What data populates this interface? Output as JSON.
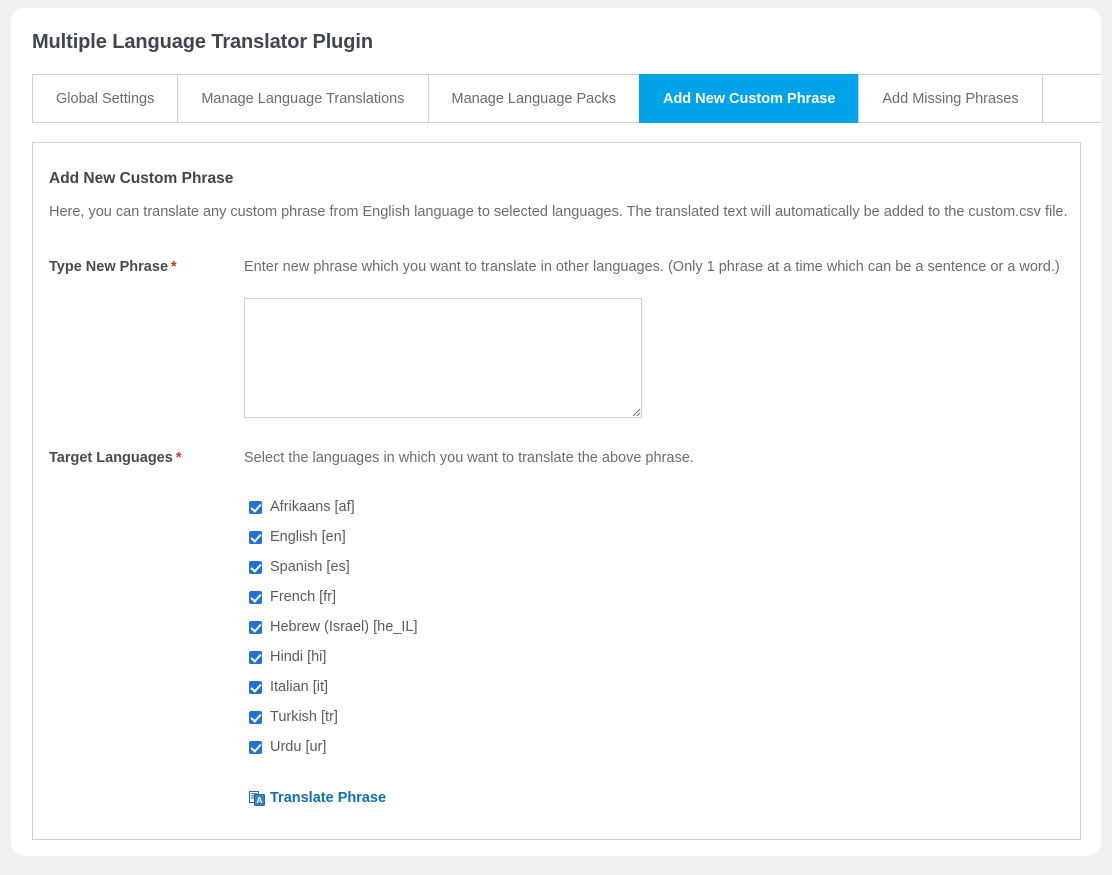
{
  "header": {
    "title": "Multiple Language Translator Plugin"
  },
  "tabs": [
    {
      "label": "Global Settings",
      "active": false
    },
    {
      "label": "Manage Language Translations",
      "active": false
    },
    {
      "label": "Manage Language Packs",
      "active": false
    },
    {
      "label": "Add New Custom Phrase",
      "active": true
    },
    {
      "label": "Add Missing Phrases",
      "active": false
    }
  ],
  "panel": {
    "title": "Add New Custom Phrase",
    "description": "Here, you can translate any custom phrase from English language to selected languages. The translated text will automatically be added to the custom.csv file."
  },
  "form": {
    "phrase": {
      "label": "Type New Phrase",
      "required_marker": "*",
      "help": "Enter new phrase which you want to translate in other languages. (Only 1 phrase at a time which can be a sentence or a word.)",
      "value": "",
      "placeholder": ""
    },
    "languages": {
      "label": "Target Languages",
      "required_marker": "*",
      "help": "Select the languages in which you want to translate the above phrase.",
      "items": [
        {
          "label": "Afrikaans [af]",
          "checked": true
        },
        {
          "label": "English [en]",
          "checked": true
        },
        {
          "label": "Spanish [es]",
          "checked": true
        },
        {
          "label": "French [fr]",
          "checked": true
        },
        {
          "label": "Hebrew (Israel) [he_IL]",
          "checked": true
        },
        {
          "label": "Hindi [hi]",
          "checked": true
        },
        {
          "label": "Italian [it]",
          "checked": true
        },
        {
          "label": "Turkish [tr]",
          "checked": true
        },
        {
          "label": "Urdu [ur]",
          "checked": true
        }
      ]
    },
    "submit": {
      "label": "Translate Phrase",
      "icon": "translate-icon"
    }
  },
  "colors": {
    "accent_blue": "#00a2e8",
    "link_blue": "#0f6fb4",
    "checkbox_blue": "#2172d6",
    "required_red": "#e02b27",
    "page_background": "#f1f1f1"
  }
}
